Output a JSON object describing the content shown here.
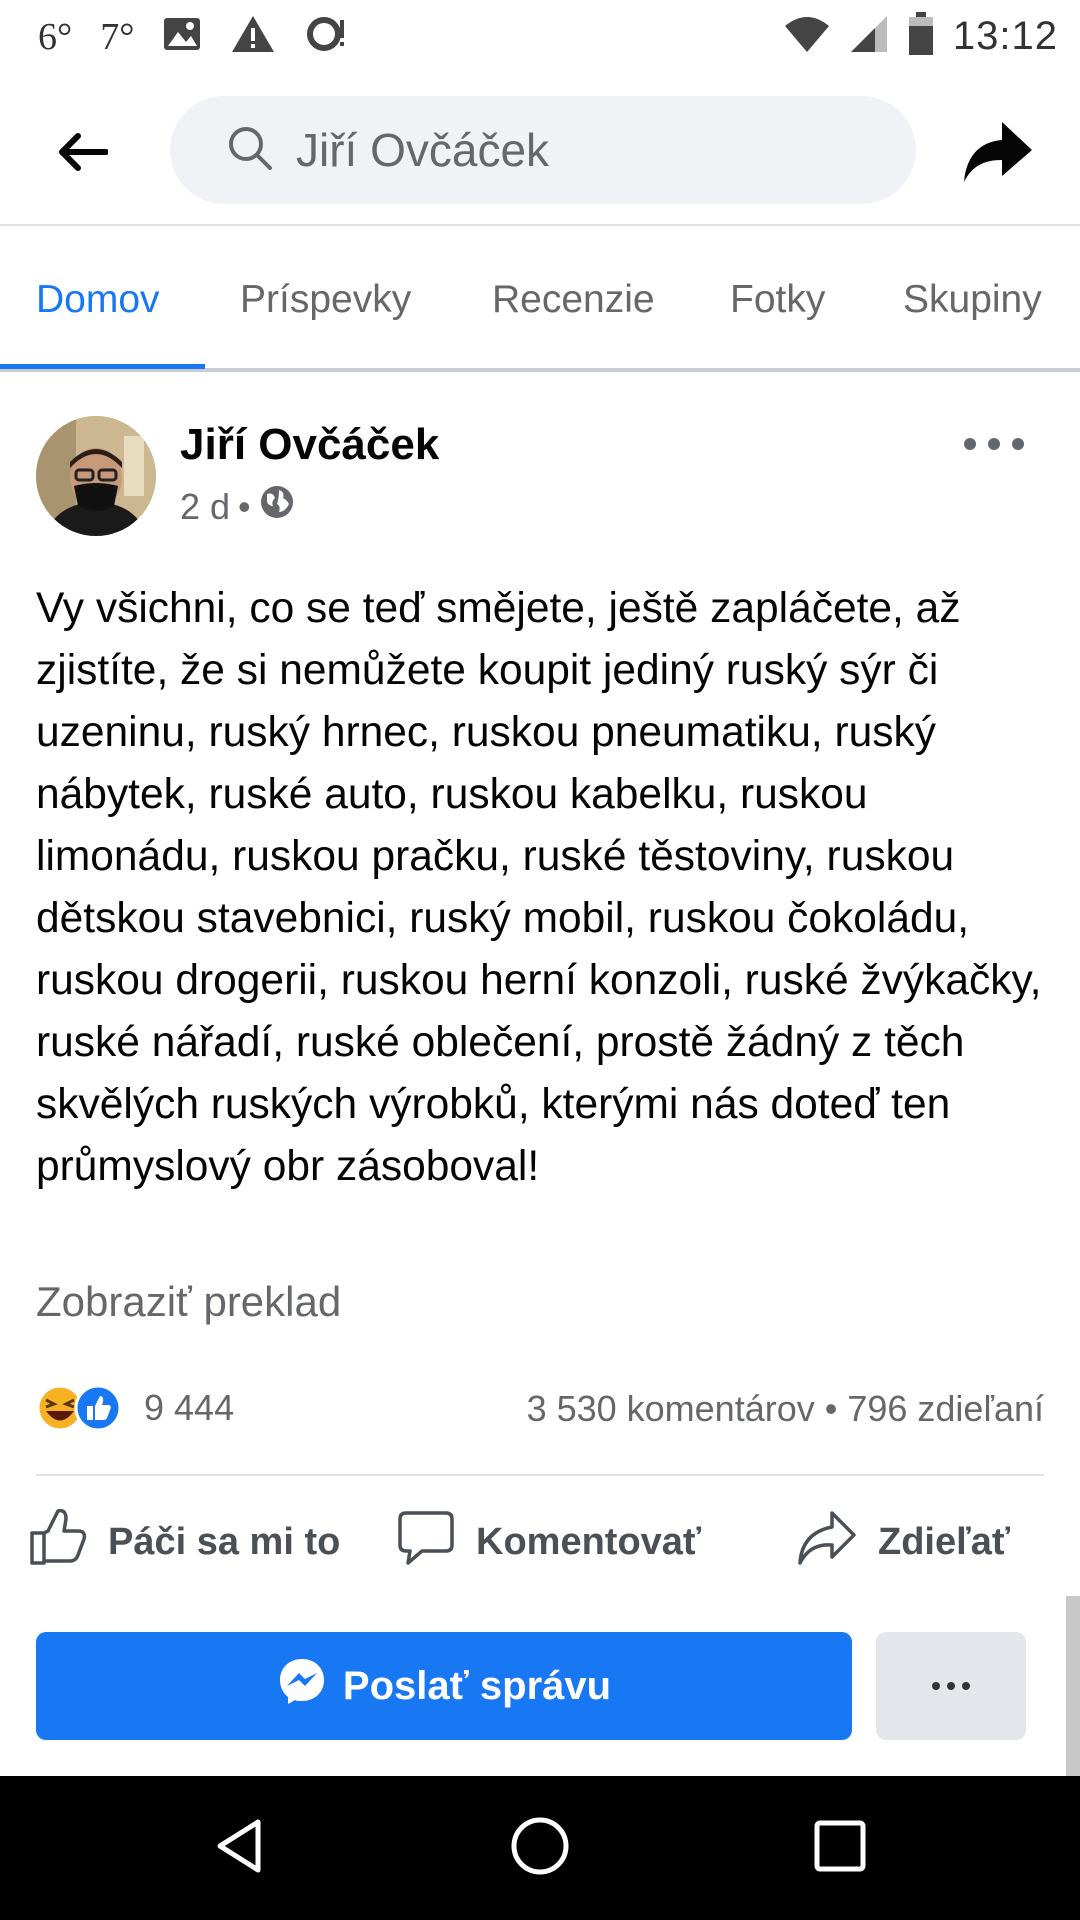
{
  "status_bar": {
    "temp1": "6°",
    "temp2": "7°",
    "time": "13:12",
    "icons": [
      "image-icon",
      "warning-icon",
      "notification-icon",
      "wifi-icon",
      "signal-icon",
      "battery-icon"
    ]
  },
  "header": {
    "search_value": "Jiří Ovčáček",
    "icons": [
      "back-arrow-icon",
      "search-icon",
      "share-icon"
    ]
  },
  "tabs": [
    {
      "label": "Domov",
      "active": true
    },
    {
      "label": "Príspevky",
      "active": false
    },
    {
      "label": "Recenzie",
      "active": false
    },
    {
      "label": "Fotky",
      "active": false
    },
    {
      "label": "Skupiny",
      "active": false
    }
  ],
  "post": {
    "author": "Jiří Ovčáček",
    "time": "2 d",
    "separator": "•",
    "text": "Vy všichni, co se teď smějete, ještě zapláčete, až zjistíte, že si nemůžete koupit jediný ruský sýr či uzeninu, ruský hrnec, ruskou pneumatiku, ruský nábytek, ruské auto, ruskou kabelku, ruskou limonádu, ruskou pračku, ruské těstoviny, ruskou dětskou stavebnici, ruský mobil, ruskou čokoládu, ruskou drogerii, ruskou herní konzoli, ruské žvýkačky, ruské nářadí, ruské oblečení, prostě žádný z těch skvělých ruských výrobků, kterými nás doteď ten průmyslový obr zásoboval!",
    "translate": "Zobraziť preklad",
    "reaction_count": "9 444",
    "stats": "3 530 komentárov • 796 zdieľaní"
  },
  "actions": {
    "like": "Páči sa mi to",
    "comment": "Komentovať",
    "share": "Zdieľať"
  },
  "message_button": "Poslať správu",
  "colors": {
    "accent": "#1877f2",
    "text_secondary": "#65676b",
    "nav_bg": "#000000"
  }
}
